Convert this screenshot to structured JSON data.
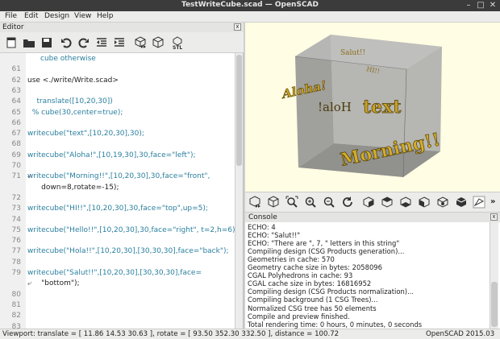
{
  "window": {
    "title": "TestWriteCube.scad — OpenSCAD"
  },
  "menu": [
    {
      "label": "File"
    },
    {
      "label": "Edit"
    },
    {
      "label": "Design"
    },
    {
      "label": "View"
    },
    {
      "label": "Help"
    }
  ],
  "editor": {
    "title": "Editor",
    "first_line": "cube otherwise",
    "line_numbers": [
      "61",
      "62",
      "63",
      "64",
      "65",
      "66",
      "67",
      "68",
      "69",
      "70",
      "71",
      "",
      "72",
      "73",
      "74",
      "75",
      "76",
      "77",
      "78",
      "79",
      "",
      "80",
      "81",
      "82",
      "83"
    ],
    "lines": [
      {
        "text": ""
      },
      {
        "text": "use <./write/Write.scad>"
      },
      {
        "text": ""
      },
      {
        "text": "    translate([10,20,30])"
      },
      {
        "text": "  % cube(30,center=true);"
      },
      {
        "text": ""
      },
      {
        "text": "writecube(\"text\",[10,20,30],30);"
      },
      {
        "text": ""
      },
      {
        "text": "writecube(\"Aloha!\",[10,19,30],30,face=\"left\");"
      },
      {
        "text": ""
      },
      {
        "text": "writecube(\"Morning!!\",[10,20,30],30,face=\"front\","
      },
      {
        "text": "      down=8,rotate=-15);"
      },
      {
        "text": ""
      },
      {
        "text": "writecube(\"HI!!\",[10,20,30],30,face=\"top\",up=5);"
      },
      {
        "text": ""
      },
      {
        "text": "writecube(\"Hello!!\",[10,20,30],30,face=\"right\", t=2,h=6);"
      },
      {
        "text": ""
      },
      {
        "text": "writecube(\"Hola!!\",[10,20,30],[30,30,30],face=\"back\");"
      },
      {
        "text": ""
      },
      {
        "text": "writecube(\"Salut!!\",[10,20,30],[30,30,30],face="
      },
      {
        "text": "      \"bottom\");"
      },
      {
        "text": ""
      },
      {
        "text": ""
      },
      {
        "text": ""
      },
      {
        "text": ""
      }
    ]
  },
  "viewport_text": {
    "aloha": "Aloha!",
    "hola": "!aloH",
    "text": "text",
    "morning": "Morning!!",
    "back_small_1": "Salut!!",
    "back_small_2": "HI!!"
  },
  "console": {
    "title": "Console",
    "lines": [
      "ECHO: 4",
      "ECHO: \"Salut!!\"",
      "ECHO: \"There are \", 7, \" letters in this string\"",
      "Compiling design (CSG Products generation)...",
      "Geometries in cache: 570",
      "Geometry cache size in bytes: 2058096",
      "CGAL Polyhedrons in cache: 93",
      "CGAL cache size in bytes: 16816952",
      "Compiling design (CSG Products normalization)...",
      "Compiling background (1 CSG Trees)...",
      "Normalized CSG tree has 50 elements",
      "Compile and preview finished.",
      "Total rendering time: 0 hours, 0 minutes, 0 seconds"
    ]
  },
  "status": {
    "viewport": "Viewport: translate = [ 11.86 14.53 30.63 ], rotate = [ 93.50 352.30 332.50 ], distance = 100.72",
    "version": "OpenSCAD 2015.03"
  },
  "colors": {
    "viewport_bg": "#fffde3",
    "cube": "#b8b8b8",
    "text_gold": "#c9a226",
    "keyword": "#2a7f9e",
    "string": "#8a2b9a"
  }
}
